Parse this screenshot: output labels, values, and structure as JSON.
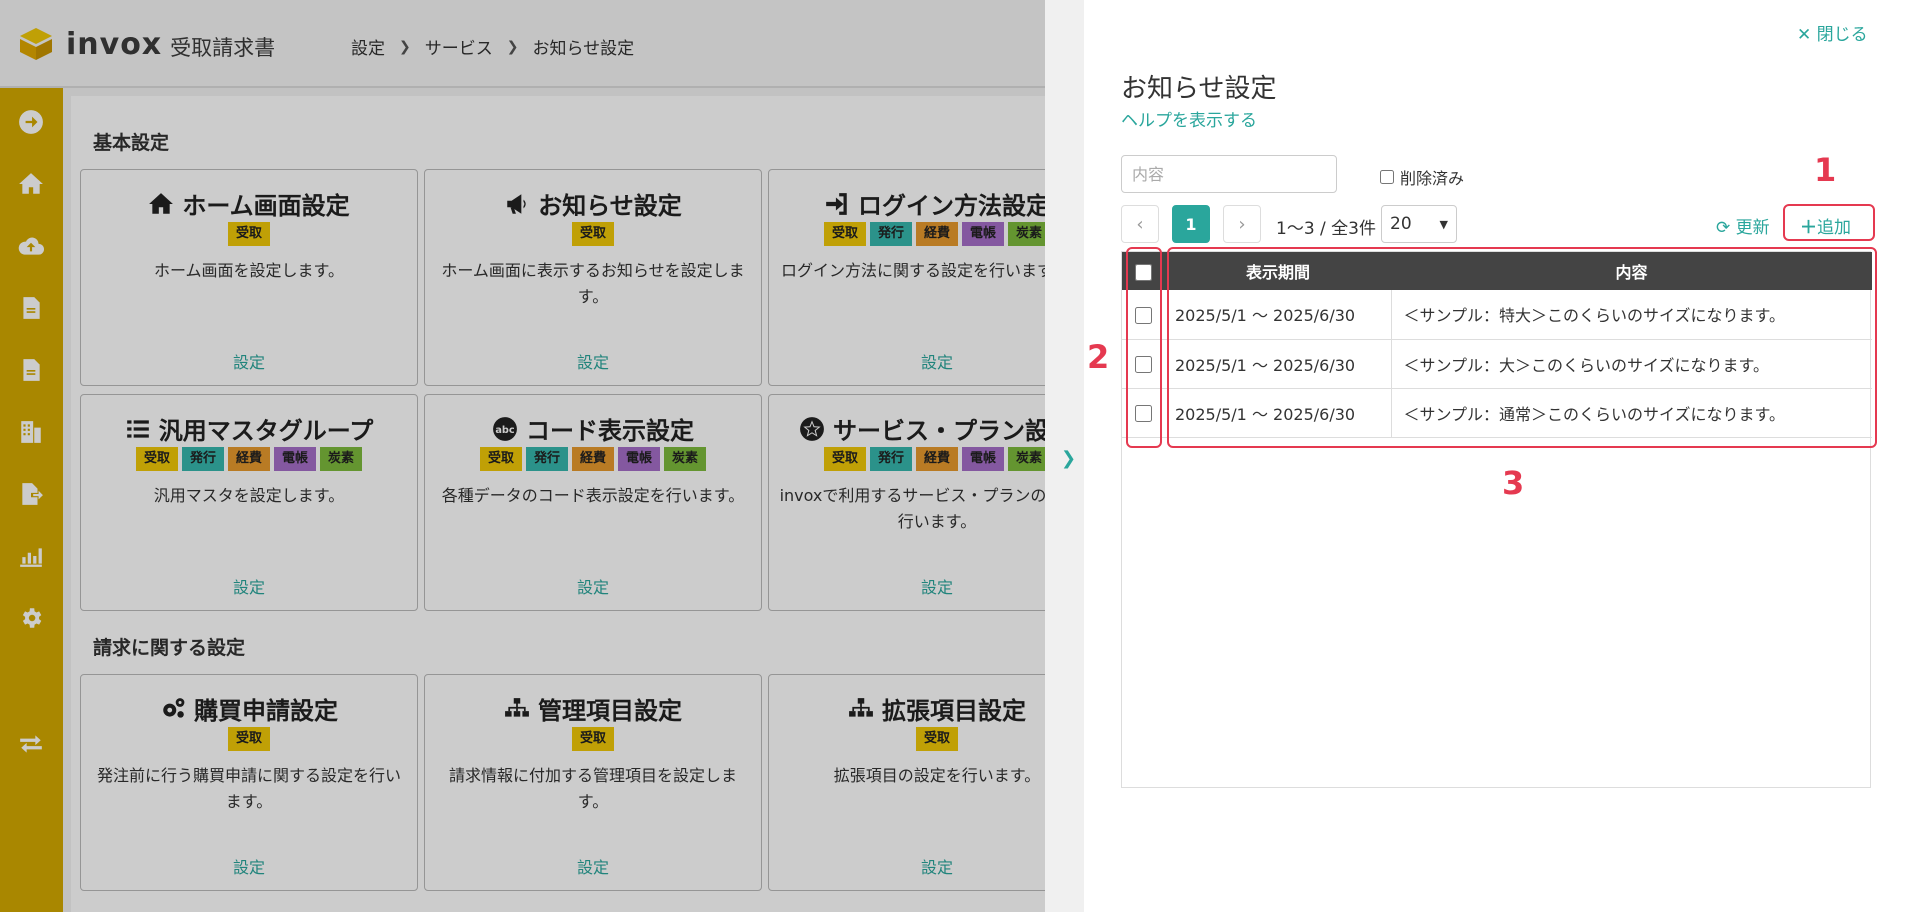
{
  "app": {
    "brand": "invox",
    "product": "受取請求書",
    "breadcrumb": [
      "設定",
      "サービス",
      "お知らせ設定"
    ]
  },
  "sidebar_icons": [
    "arrow-right-circle-icon",
    "home-icon",
    "cloud-upload-icon",
    "document-icon",
    "document-icon",
    "building-icon",
    "file-export-icon",
    "chart-icon",
    "gear-icon",
    "exchange-icon"
  ],
  "sections": {
    "basic": "基本設定",
    "invoice": "請求に関する設定"
  },
  "tags": {
    "receive": {
      "label": "受取",
      "color": "#f0c808"
    },
    "issue": {
      "label": "発行",
      "color": "#36b7ad"
    },
    "expense": {
      "label": "経費",
      "color": "#e89a2e"
    },
    "ledger": {
      "label": "電帳",
      "color": "#a66ec8"
    },
    "carbon": {
      "label": "炭素",
      "color": "#7dbb3c"
    }
  },
  "cards": [
    {
      "title": "ホーム画面設定",
      "icon": "home-icon",
      "desc": "ホーム画面を設定します。",
      "link": "設定"
    },
    {
      "title": "お知らせ設定",
      "icon": "megaphone-icon",
      "desc": "ホーム画面に表示するお知らせを設定します。",
      "link": "設定"
    },
    {
      "title": "ログイン方法設定",
      "icon": "sign-in-icon",
      "desc": "ログイン方法に関する設定を行います。",
      "link": "設定"
    },
    {
      "title": "汎用マスタグループ",
      "icon": "list-icon",
      "desc": "汎用マスタを設定します。",
      "link": "設定"
    },
    {
      "title": "コード表示設定",
      "icon": "abc-icon",
      "desc": "各種データのコード表示設定を行います。",
      "link": "設定"
    },
    {
      "title": "サービス・プラン設定",
      "icon": "star-badge-icon",
      "desc": "invoxで利用するサービス・プランの設定を行います。",
      "link": "設定"
    },
    {
      "title": "購買申請設定",
      "icon": "gears-icon",
      "desc": "発注前に行う購買申請に関する設定を行います。",
      "link": "設定"
    },
    {
      "title": "管理項目設定",
      "icon": "sitemap-icon",
      "desc": "請求情報に付加する管理項目を設定します。",
      "link": "設定"
    },
    {
      "title": "拡張項目設定",
      "icon": "sitemap-icon",
      "desc": "拡張項目の設定を行います。",
      "link": "設定"
    }
  ],
  "panel": {
    "close_label": "閉じる",
    "title": "お知らせ設定",
    "help_label": "ヘルプを表示する",
    "search_placeholder": "内容",
    "deleted_label": "削除済み",
    "page_current": "1",
    "page_info": "1〜3 / 全3件",
    "page_size": "20",
    "refresh_label": "更新",
    "add_label": "追加",
    "columns": [
      "表示期間",
      "内容"
    ],
    "rows": [
      {
        "period": "2025/5/1 〜 2025/6/30",
        "content": "＜サンプル：特大＞このくらいのサイズになります。"
      },
      {
        "period": "2025/5/1 〜 2025/6/30",
        "content": "＜サンプル：大＞このくらいのサイズになります。"
      },
      {
        "period": "2025/5/1 〜 2025/6/30",
        "content": "＜サンプル：通常＞このくらいのサイズになります。"
      }
    ]
  },
  "annotations": [
    "1",
    "2",
    "3"
  ],
  "colors": {
    "accent": "#2aa69c",
    "sidebar": "#d4a900",
    "highlight": "#e53950"
  }
}
